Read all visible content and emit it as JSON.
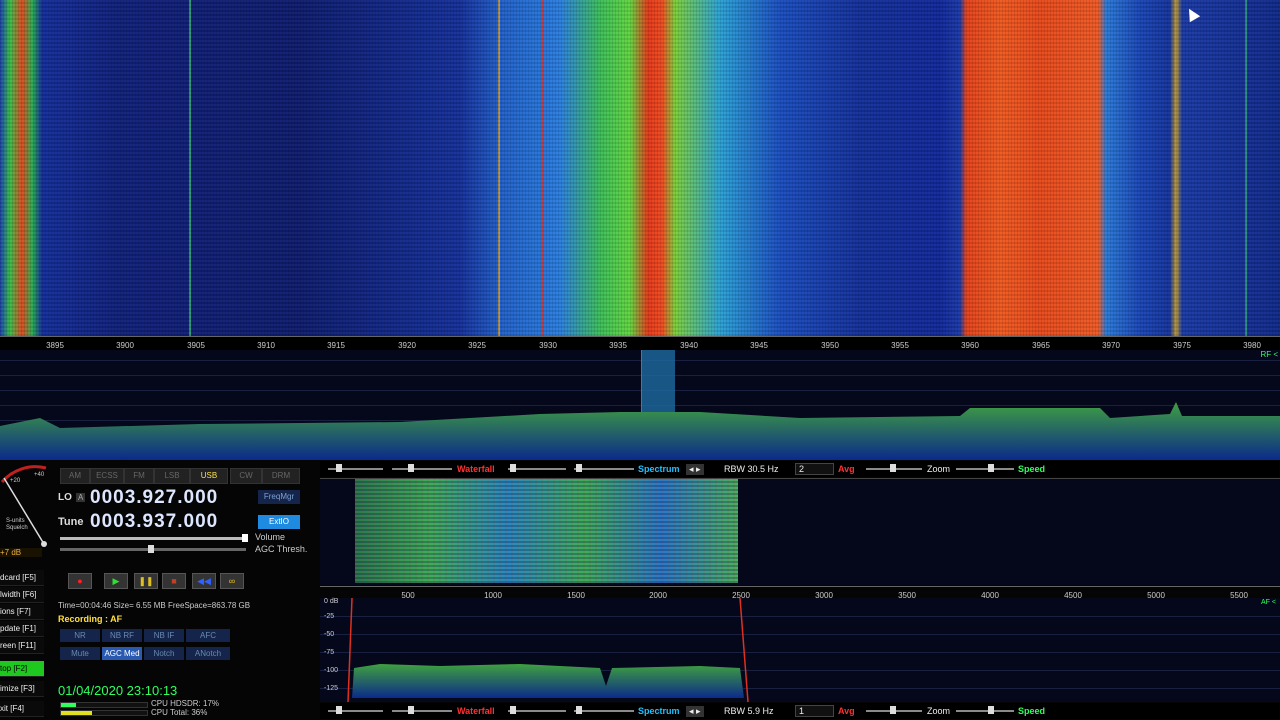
{
  "main_scale": {
    "ticks": [
      "3895",
      "3900",
      "3905",
      "3910",
      "3915",
      "3920",
      "3925",
      "3930",
      "3935",
      "3940",
      "3945",
      "3950",
      "3955",
      "3960",
      "3965",
      "3970",
      "3975",
      "3980"
    ],
    "rf_label": "RF <"
  },
  "toolbar_top": {
    "waterfall": "Waterfall",
    "spectrum": "Spectrum",
    "rbw": "RBW 30.5 Hz",
    "avg_value": "2",
    "avg": "Avg",
    "zoom": "Zoom",
    "speed": "Speed"
  },
  "toolbar_bottom": {
    "waterfall": "Waterfall",
    "spectrum": "Spectrum",
    "rbw": "RBW  5.9 Hz",
    "avg_value": "1",
    "avg": "Avg",
    "zoom": "Zoom",
    "speed": "Speed"
  },
  "af_scale": {
    "ticks": [
      "500",
      "1000",
      "1500",
      "2000",
      "2500",
      "3000",
      "3500",
      "4000",
      "4500",
      "5000",
      "5500"
    ],
    "af_label": "AF <",
    "db_ticks": [
      "0 dB",
      "-25",
      "-50",
      "-75",
      "-100",
      "-125"
    ]
  },
  "smeter": {
    "plus20": "+20",
    "plus40": "+40",
    "sunits": "S-units",
    "squelch": "Squelch",
    "db": "+7 dB"
  },
  "modes": [
    {
      "label": "AM",
      "active": false
    },
    {
      "label": "ECSS",
      "active": false
    },
    {
      "label": "FM",
      "active": false
    },
    {
      "label": "LSB",
      "active": false
    },
    {
      "label": "USB",
      "active": true
    },
    {
      "label": "CW",
      "active": false
    },
    {
      "label": "DRM",
      "active": false
    }
  ],
  "lo": {
    "label": "LO",
    "sub": "A",
    "value": "0003.927.000"
  },
  "tune": {
    "label": "Tune",
    "value": "0003.937.000"
  },
  "buttons": {
    "freqmgr": "FreqMgr",
    "extio": "ExtIO"
  },
  "volume": "Volume",
  "agc_thresh": "AGC Thresh.",
  "recorder": {
    "info": "Time=00:04:46  Size= 6.55 MB  FreeSpace=863.78 GB",
    "recording": "Recording : AF"
  },
  "dsp": [
    {
      "label": "NR",
      "on": false
    },
    {
      "label": "NB RF",
      "on": false
    },
    {
      "label": "NB IF",
      "on": false
    },
    {
      "label": "AFC",
      "on": false
    },
    {
      "label": "Mute",
      "on": false
    },
    {
      "label": "AGC Med",
      "on": true
    },
    {
      "label": "Notch",
      "on": false
    },
    {
      "label": "ANotch",
      "on": false
    }
  ],
  "sidebar": [
    {
      "label": "dcard [F5]",
      "active": false
    },
    {
      "label": "lwidth [F6]",
      "active": false
    },
    {
      "label": "ions  [F7]",
      "active": false
    },
    {
      "label": "pdate [F1]",
      "active": false
    },
    {
      "label": "reen [F11]",
      "active": false
    },
    {
      "label": "top    [F2]",
      "active": true
    },
    {
      "label": "imize [F3]",
      "active": false
    },
    {
      "label": "xit     [F4]",
      "active": false
    }
  ],
  "datetime": "01/04/2020 23:10:13",
  "cpu": {
    "hdsdr": "CPU HDSDR: 17%",
    "total": "CPU Total: 36%"
  },
  "colors": {
    "accent_green": "#30ff60",
    "accent_red": "#ff3030",
    "accent_cyan": "#20c0ff",
    "digits": "#dde6ff"
  }
}
